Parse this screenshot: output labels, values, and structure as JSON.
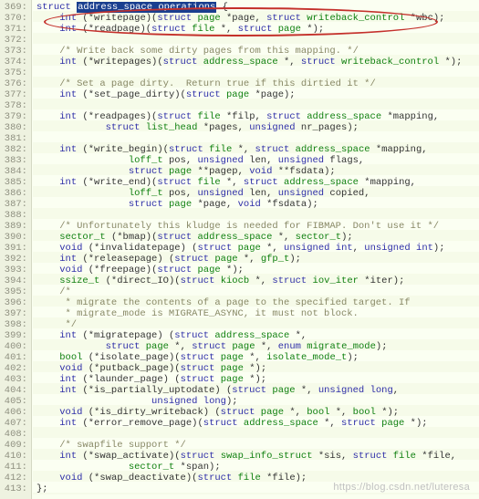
{
  "watermark": "https://blog.csdn.net/luteresa",
  "first_line": 369,
  "lines": [
    {
      "i": 0,
      "html": "<span class='kw'>struct</span> <span class='sel'>address_space_operations</span> {"
    },
    {
      "i": 1,
      "html": "    <span class='kw'>int</span> (*<span class='nm'>writepage</span>)(<span class='kw'>struct</span> <span class='ty'>page</span> *page, <span class='kw'>struct</span> <span class='ty'>writeback_control</span> *wbc);"
    },
    {
      "i": 2,
      "html": "    <span class='kw'>int</span> (*<span class='nm'>readpage</span>)(<span class='kw'>struct</span> <span class='ty'>file</span> *, <span class='kw'>struct</span> <span class='ty'>page</span> *);"
    },
    {
      "i": 3,
      "html": ""
    },
    {
      "i": 4,
      "html": "    <span class='cm'>/* Write back some dirty pages from this mapping. */</span>"
    },
    {
      "i": 5,
      "html": "    <span class='kw'>int</span> (*<span class='nm'>writepages</span>)(<span class='kw'>struct</span> <span class='ty'>address_space</span> *, <span class='kw'>struct</span> <span class='ty'>writeback_control</span> *);"
    },
    {
      "i": 6,
      "html": ""
    },
    {
      "i": 7,
      "html": "    <span class='cm'>/* Set a page dirty.  Return true if this dirtied it */</span>"
    },
    {
      "i": 8,
      "html": "    <span class='kw'>int</span> (*<span class='nm'>set_page_dirty</span>)(<span class='kw'>struct</span> <span class='ty'>page</span> *page);"
    },
    {
      "i": 9,
      "html": ""
    },
    {
      "i": 10,
      "html": "    <span class='kw'>int</span> (*<span class='nm'>readpages</span>)(<span class='kw'>struct</span> <span class='ty'>file</span> *filp, <span class='kw'>struct</span> <span class='ty'>address_space</span> *mapping,"
    },
    {
      "i": 11,
      "html": "            <span class='kw'>struct</span> <span class='ty'>list_head</span> *pages, <span class='kw'>unsigned</span> nr_pages);"
    },
    {
      "i": 12,
      "html": ""
    },
    {
      "i": 13,
      "html": "    <span class='kw'>int</span> (*<span class='nm'>write_begin</span>)(<span class='kw'>struct</span> <span class='ty'>file</span> *, <span class='kw'>struct</span> <span class='ty'>address_space</span> *mapping,"
    },
    {
      "i": 14,
      "html": "                <span class='ty'>loff_t</span> pos, <span class='kw'>unsigned</span> len, <span class='kw'>unsigned</span> flags,"
    },
    {
      "i": 15,
      "html": "                <span class='kw'>struct</span> <span class='ty'>page</span> **pagep, <span class='kw'>void</span> **fsdata);"
    },
    {
      "i": 16,
      "html": "    <span class='kw'>int</span> (*<span class='nm'>write_end</span>)(<span class='kw'>struct</span> <span class='ty'>file</span> *, <span class='kw'>struct</span> <span class='ty'>address_space</span> *mapping,"
    },
    {
      "i": 17,
      "html": "                <span class='ty'>loff_t</span> pos, <span class='kw'>unsigned</span> len, <span class='kw'>unsigned</span> copied,"
    },
    {
      "i": 18,
      "html": "                <span class='kw'>struct</span> <span class='ty'>page</span> *page, <span class='kw'>void</span> *fsdata);"
    },
    {
      "i": 19,
      "html": ""
    },
    {
      "i": 20,
      "html": "    <span class='cm'>/* Unfortunately this kludge is needed for FIBMAP. Don't use it */</span>"
    },
    {
      "i": 21,
      "html": "    <span class='ty'>sector_t</span> (*<span class='nm'>bmap</span>)(<span class='kw'>struct</span> <span class='ty'>address_space</span> *, <span class='ty'>sector_t</span>);"
    },
    {
      "i": 22,
      "html": "    <span class='kw'>void</span> (*<span class='nm'>invalidatepage</span>) (<span class='kw'>struct</span> <span class='ty'>page</span> *, <span class='kw'>unsigned</span> <span class='kw'>int</span>, <span class='kw'>unsigned</span> <span class='kw'>int</span>);"
    },
    {
      "i": 23,
      "html": "    <span class='kw'>int</span> (*<span class='nm'>releasepage</span>) (<span class='kw'>struct</span> <span class='ty'>page</span> *, <span class='ty'>gfp_t</span>);"
    },
    {
      "i": 24,
      "html": "    <span class='kw'>void</span> (*<span class='nm'>freepage</span>)(<span class='kw'>struct</span> <span class='ty'>page</span> *);"
    },
    {
      "i": 25,
      "html": "    <span class='ty'>ssize_t</span> (*<span class='nm'>direct_IO</span>)(<span class='kw'>struct</span> <span class='ty'>kiocb</span> *, <span class='kw'>struct</span> <span class='ty'>iov_iter</span> *iter);"
    },
    {
      "i": 26,
      "html": "    <span class='cm'>/*</span>"
    },
    {
      "i": 27,
      "html": "<span class='cm'>     * migrate the contents of a page to the specified target. If</span>"
    },
    {
      "i": 28,
      "html": "<span class='cm'>     * migrate_mode is MIGRATE_ASYNC, it must not block.</span>"
    },
    {
      "i": 29,
      "html": "<span class='cm'>     */</span>"
    },
    {
      "i": 30,
      "html": "    <span class='kw'>int</span> (*<span class='nm'>migratepage</span>) (<span class='kw'>struct</span> <span class='ty'>address_space</span> *,"
    },
    {
      "i": 31,
      "html": "            <span class='kw'>struct</span> <span class='ty'>page</span> *, <span class='kw'>struct</span> <span class='ty'>page</span> *, <span class='kw'>enum</span> <span class='ty'>migrate_mode</span>);"
    },
    {
      "i": 32,
      "html": "    <span class='ty'>bool</span> (*<span class='nm'>isolate_page</span>)(<span class='kw'>struct</span> <span class='ty'>page</span> *, <span class='ty'>isolate_mode_t</span>);"
    },
    {
      "i": 33,
      "html": "    <span class='kw'>void</span> (*<span class='nm'>putback_page</span>)(<span class='kw'>struct</span> <span class='ty'>page</span> *);"
    },
    {
      "i": 34,
      "html": "    <span class='kw'>int</span> (*<span class='nm'>launder_page</span>) (<span class='kw'>struct</span> <span class='ty'>page</span> *);"
    },
    {
      "i": 35,
      "html": "    <span class='kw'>int</span> (*<span class='nm'>is_partially_uptodate</span>) (<span class='kw'>struct</span> <span class='ty'>page</span> *, <span class='kw'>unsigned</span> <span class='kw'>long</span>,"
    },
    {
      "i": 36,
      "html": "                    <span class='kw'>unsigned</span> <span class='kw'>long</span>);"
    },
    {
      "i": 37,
      "html": "    <span class='kw'>void</span> (*<span class='nm'>is_dirty_writeback</span>) (<span class='kw'>struct</span> <span class='ty'>page</span> *, <span class='ty'>bool</span> *, <span class='ty'>bool</span> *);"
    },
    {
      "i": 38,
      "html": "    <span class='kw'>int</span> (*<span class='nm'>error_remove_page</span>)(<span class='kw'>struct</span> <span class='ty'>address_space</span> *, <span class='kw'>struct</span> <span class='ty'>page</span> *);"
    },
    {
      "i": 39,
      "html": ""
    },
    {
      "i": 40,
      "html": "    <span class='cm'>/* swapfile support */</span>"
    },
    {
      "i": 41,
      "html": "    <span class='kw'>int</span> (*<span class='nm'>swap_activate</span>)(<span class='kw'>struct</span> <span class='ty'>swap_info_struct</span> *sis, <span class='kw'>struct</span> <span class='ty'>file</span> *file,"
    },
    {
      "i": 42,
      "html": "                <span class='ty'>sector_t</span> *span);"
    },
    {
      "i": 43,
      "html": "    <span class='kw'>void</span> (*<span class='nm'>swap_deactivate</span>)(<span class='kw'>struct</span> <span class='ty'>file</span> *file);"
    },
    {
      "i": 44,
      "html": "};"
    }
  ]
}
